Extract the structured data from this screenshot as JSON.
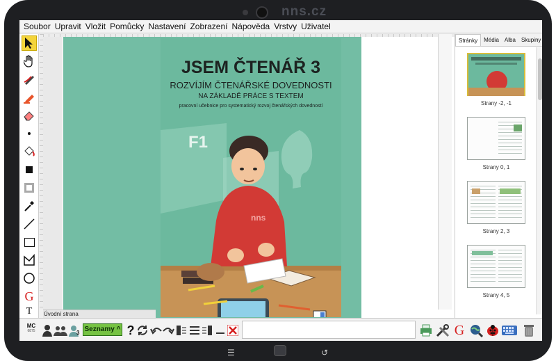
{
  "device": {
    "brand": "nns.cz",
    "nav_icons": [
      "menu-icon",
      "home-icon",
      "back-icon"
    ]
  },
  "menubar": {
    "items": [
      "Soubor",
      "Upravit",
      "Vložit",
      "Pomůcky",
      "Nastavení",
      "Zobrazení",
      "Nápověda",
      "Vrstvy",
      "Uživatel"
    ]
  },
  "left_tools": [
    "pointer-arrow-icon",
    "hand-icon",
    "pen-icon",
    "highlighter-icon",
    "eraser-icon",
    "dot-icon",
    "fill-bucket-icon",
    "square-fill-icon",
    "frame-icon",
    "eyedropper-icon",
    "line-icon",
    "rectangle-icon",
    "polygon-icon",
    "ellipse-icon",
    "text-g-icon",
    "text-t-icon"
  ],
  "canvas": {
    "page_label": "Úvodní strana",
    "book": {
      "title": "JSEM ČTENÁŘ 3",
      "subtitle": "ROZVÍJÍM ČTENÁŘSKÉ DOVEDNOSTI",
      "subtitle2": "NA ZÁKLADĚ PRÁCE S TEXTEM",
      "subtitle3": "pracovní učebnice pro systematický rozvoj čtenářských dovedností",
      "badge": "F1",
      "logo": "nns"
    }
  },
  "panel": {
    "tabs": [
      "Stránky",
      "Média",
      "Alba",
      "Skupiny"
    ],
    "active_tab": "Stránky",
    "thumbnails": [
      "Strany -2, -1",
      "Strany 0, 1",
      "Strany 2, 3",
      "Strany 4, 5"
    ]
  },
  "bottom": {
    "mc_label": "MC",
    "mc_sub": "6875",
    "count_badge": "3",
    "seznamy_label": "Seznamy ^",
    "help_glyph": "?",
    "right_icons": [
      "printer-icon",
      "tools-icon",
      "google-icon",
      "search-globe-icon",
      "ladybug-icon",
      "keyboard-icon",
      "trash-icon"
    ]
  },
  "colors": {
    "cover_green": "#6cb99e",
    "selection_yellow": "#f4d43a",
    "seznamy_green": "#76c343",
    "red_accent": "#d62020"
  }
}
